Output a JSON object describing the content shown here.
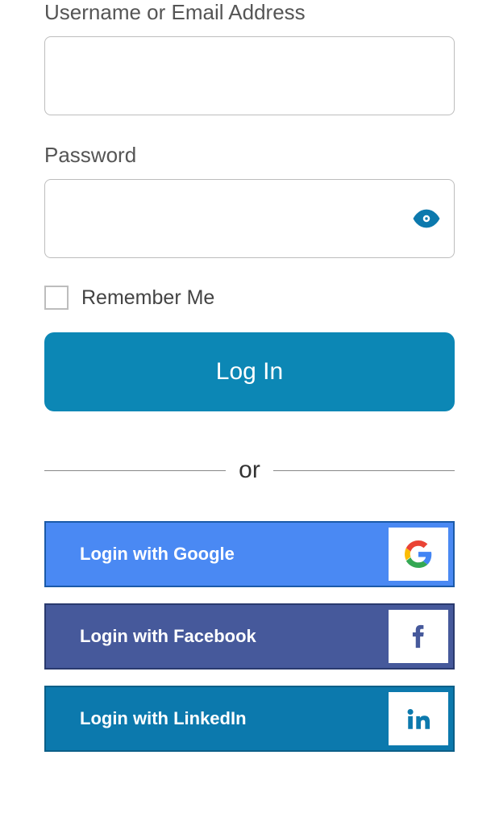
{
  "fields": {
    "username": {
      "label": "Username or Email Address",
      "value": ""
    },
    "password": {
      "label": "Password",
      "value": ""
    }
  },
  "remember": {
    "label": "Remember Me",
    "checked": false
  },
  "login_button": "Log In",
  "divider": "or",
  "social": {
    "google": {
      "label": "Login with Google"
    },
    "facebook": {
      "label": "Login with Facebook"
    },
    "linkedin": {
      "label": "Login with LinkedIn"
    }
  }
}
